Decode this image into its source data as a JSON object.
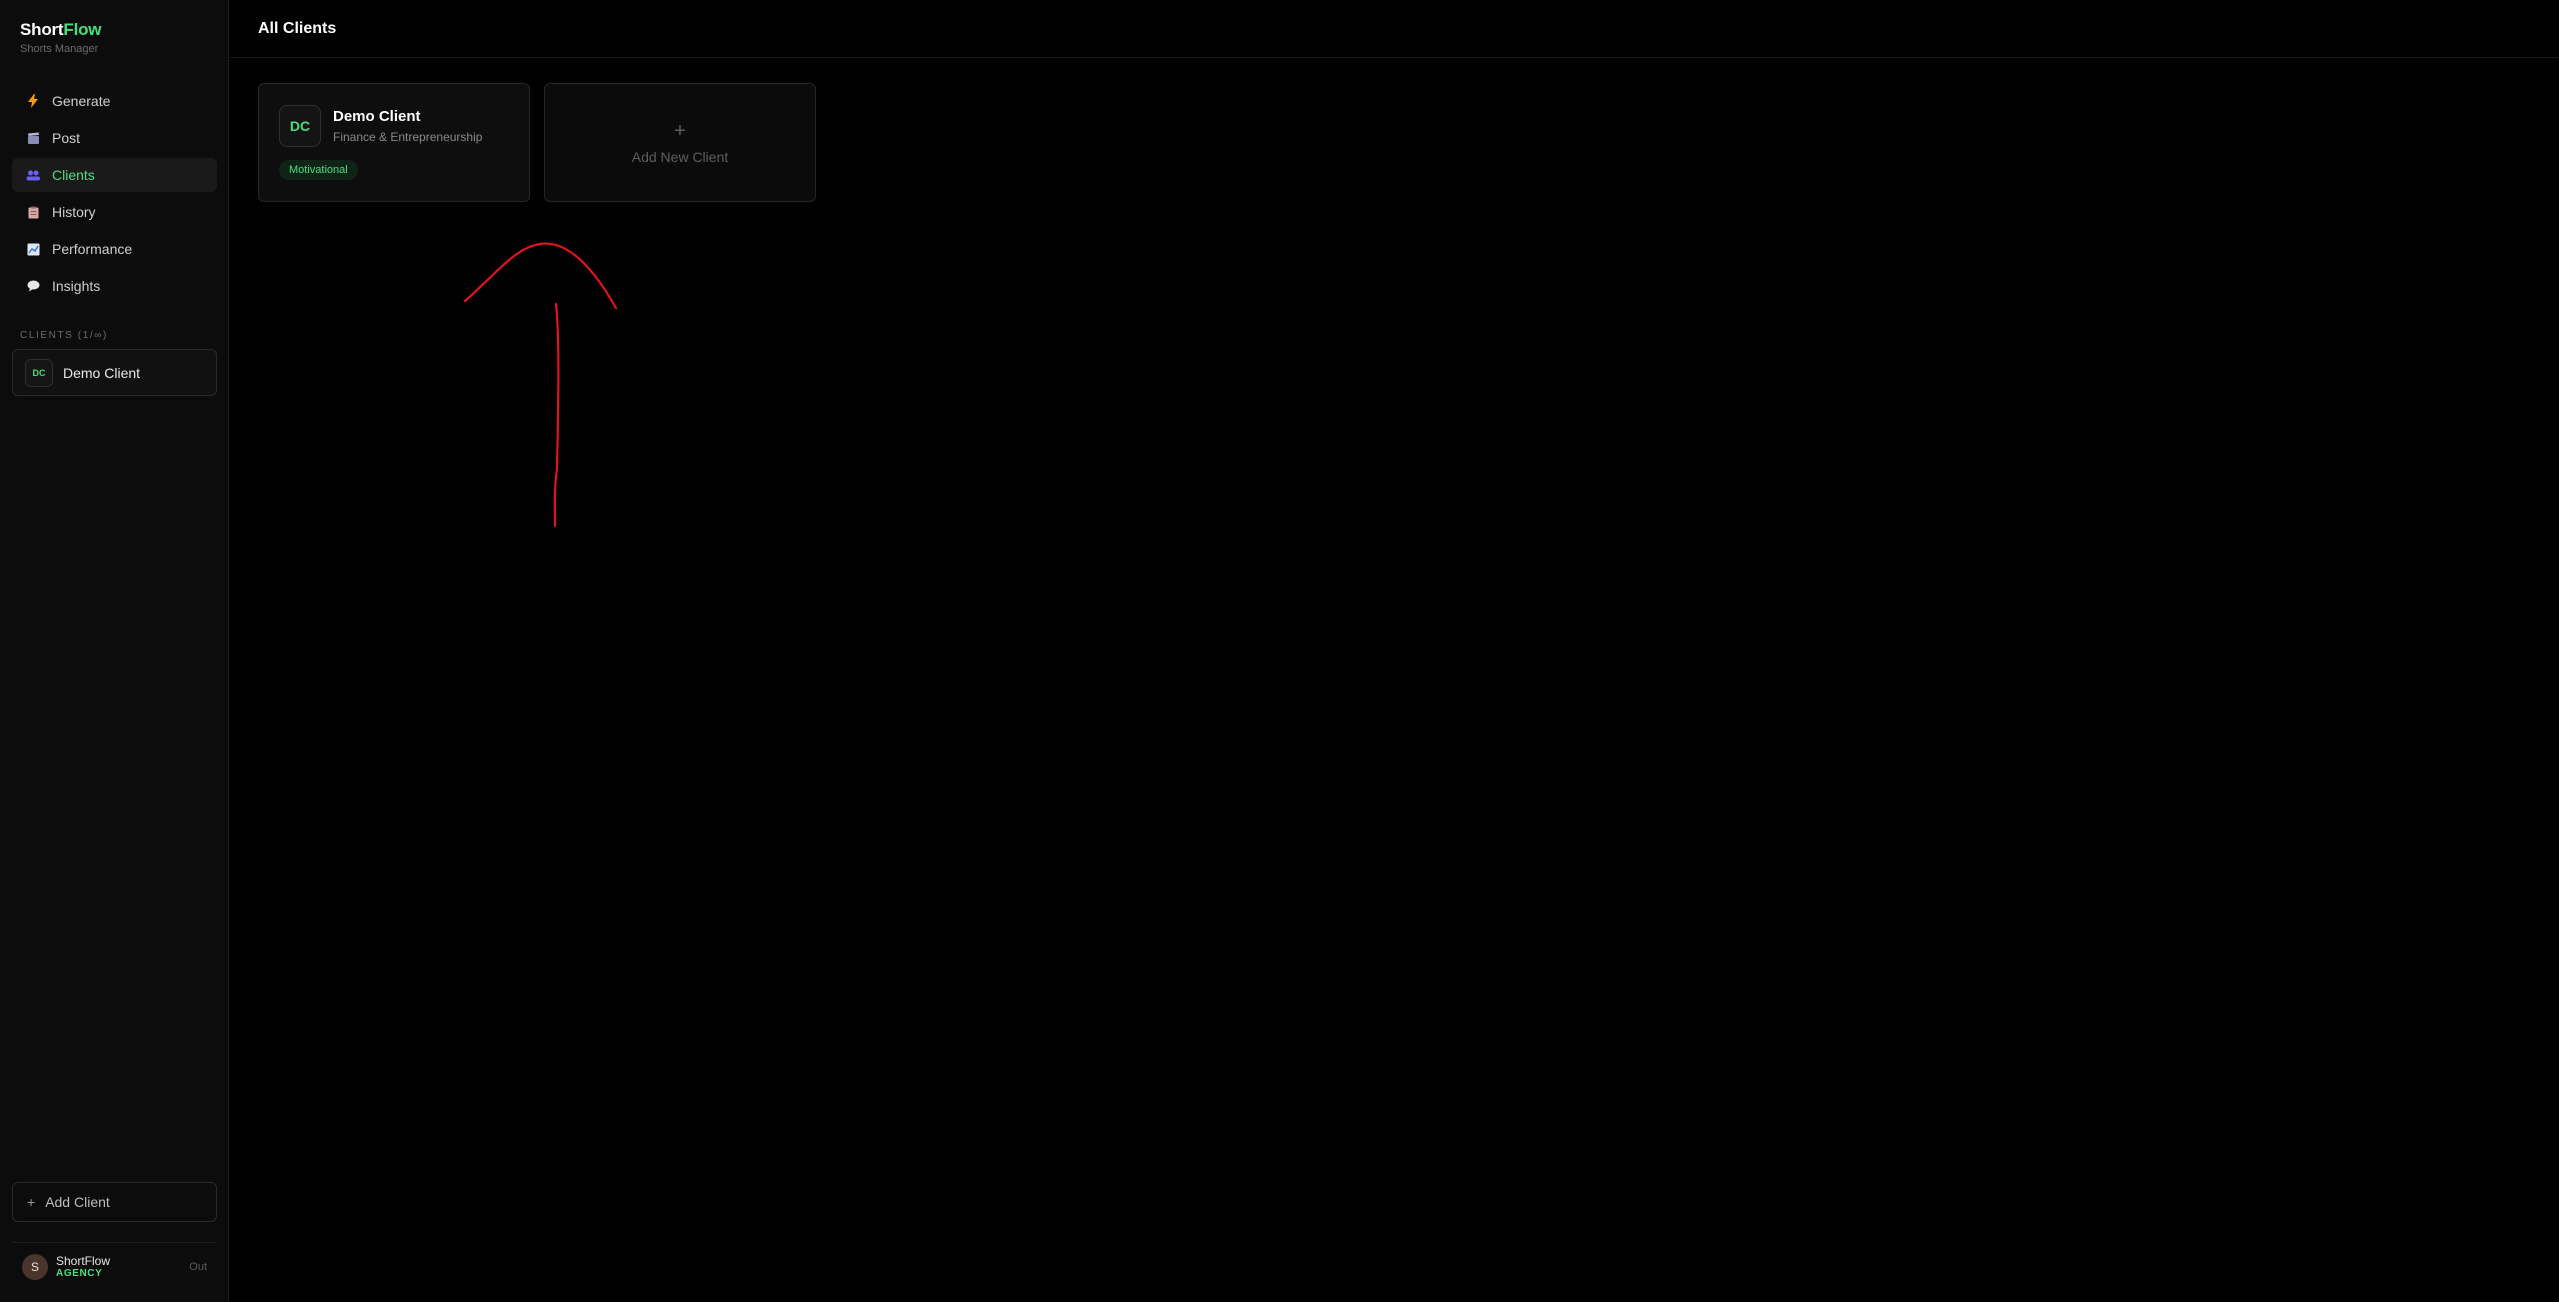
{
  "brand": {
    "name_part1": "Short",
    "name_part2": "Flow",
    "subtitle": "Shorts Manager"
  },
  "sidebar": {
    "items": [
      {
        "label": "Generate",
        "icon": "lightning-icon",
        "color": "#f59e0b"
      },
      {
        "label": "Post",
        "icon": "clapperboard-icon",
        "color": "#8b8bb8"
      },
      {
        "label": "Clients",
        "icon": "users-icon",
        "color": "#6d5dfc",
        "active": true
      },
      {
        "label": "History",
        "icon": "clipboard-icon",
        "color": "#d9a8a8"
      },
      {
        "label": "Performance",
        "icon": "chart-icon",
        "color": "#9fb4d8"
      },
      {
        "label": "Insights",
        "icon": "speech-bubble-icon",
        "color": "#e6e6e6"
      }
    ],
    "clients_section_label": "CLIENTS (1/∞)",
    "clients": [
      {
        "initials": "DC",
        "name": "Demo Client"
      }
    ],
    "add_client_label": "Add Client",
    "add_client_symbol": "+"
  },
  "user": {
    "avatar_initial": "S",
    "name": "ShortFlow",
    "plan": "AGENCY",
    "logout_label": "Out"
  },
  "header": {
    "title": "All Clients"
  },
  "cards": {
    "client": {
      "initials": "DC",
      "name": "Demo Client",
      "niche": "Finance & Entrepreneurship",
      "tag": "Motivational"
    },
    "add_new": {
      "symbol": "+",
      "label": "Add New Client"
    }
  },
  "colors": {
    "accent": "#4ade80",
    "background": "#000000",
    "annotation": "#e0141c"
  }
}
